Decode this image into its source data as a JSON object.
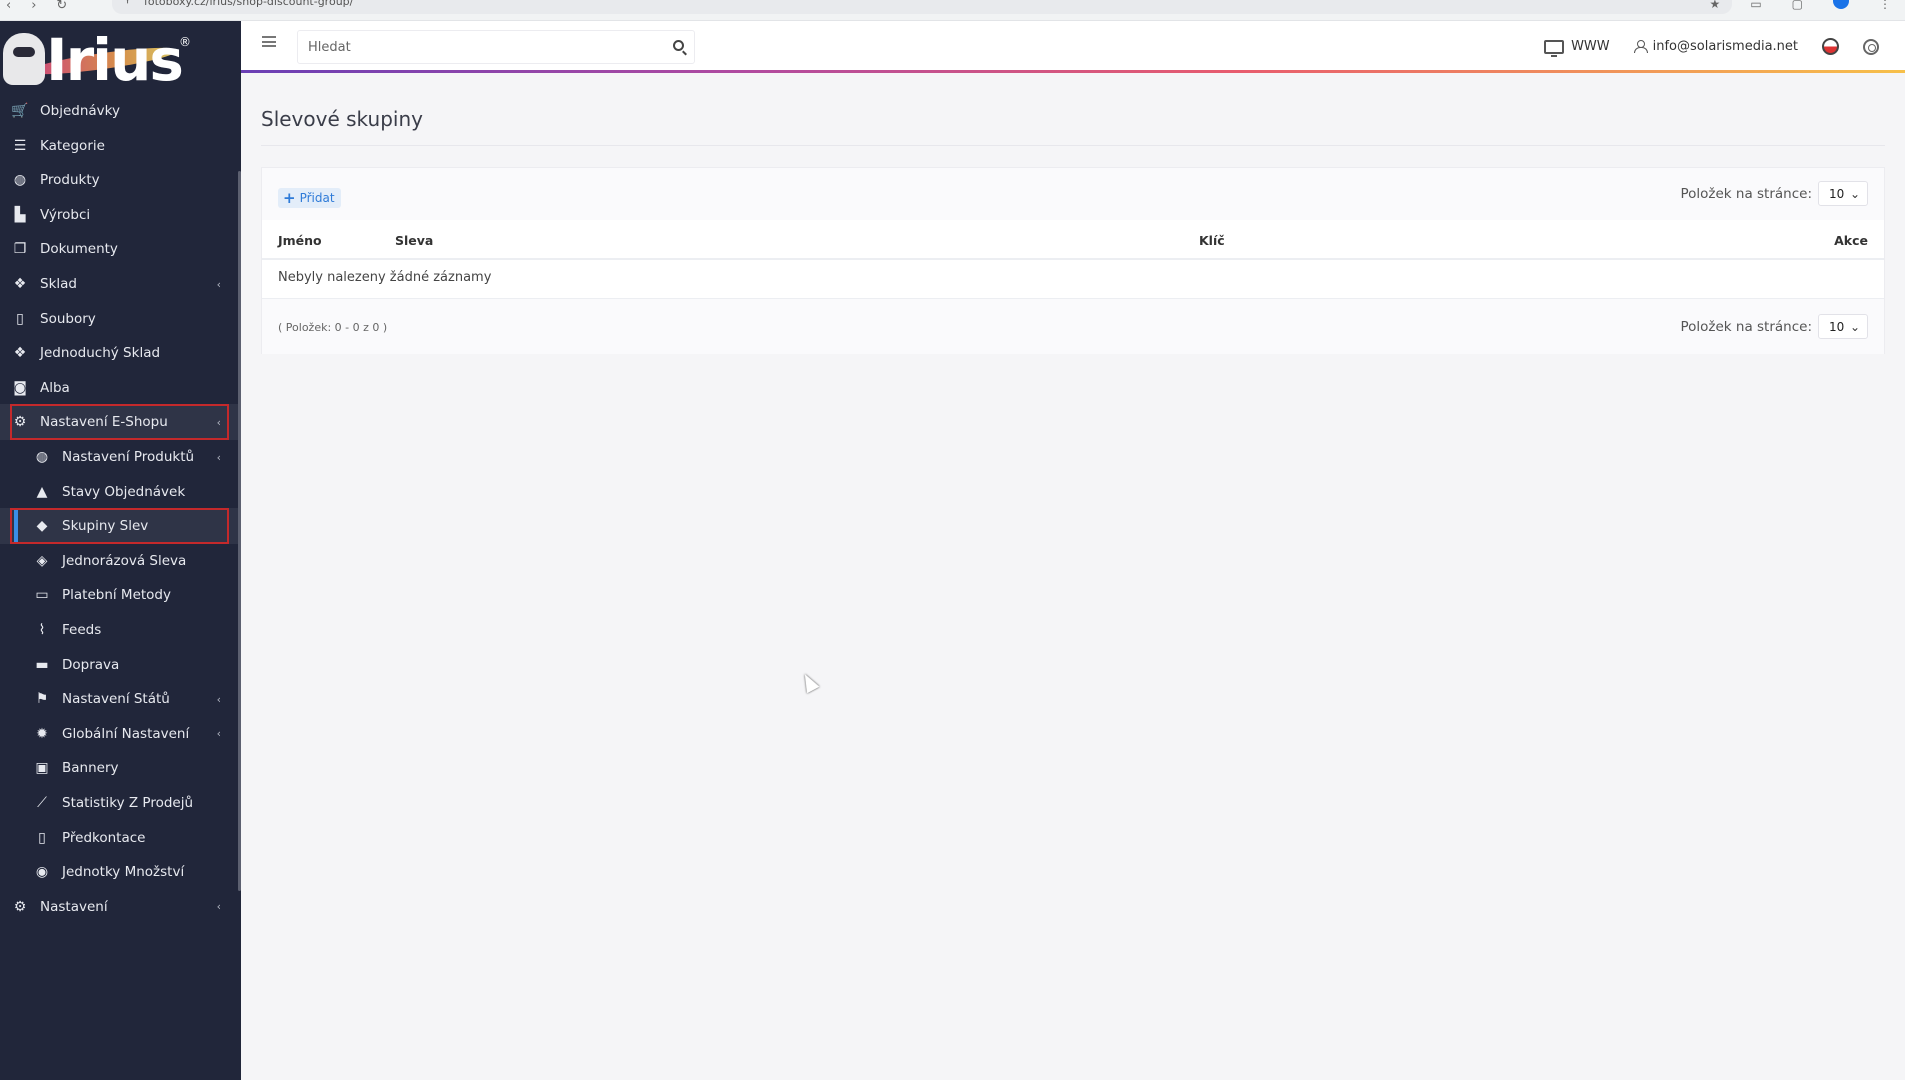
{
  "browser": {
    "url": "fotoboxy.cz/irius/shop-discount-group/",
    "nav_icons": [
      "back-icon",
      "forward-icon",
      "reload-icon"
    ]
  },
  "brand": {
    "logo_text": "Irius",
    "registered": "®"
  },
  "sidebar": {
    "items": [
      {
        "label": "Objednávky",
        "icon": "cart-icon",
        "sub": false
      },
      {
        "label": "Kategorie",
        "icon": "list-icon",
        "sub": false
      },
      {
        "label": "Produkty",
        "icon": "ball-icon",
        "sub": false
      },
      {
        "label": "Výrobci",
        "icon": "factory-icon",
        "sub": false
      },
      {
        "label": "Dokumenty",
        "icon": "documents-icon",
        "sub": false
      },
      {
        "label": "Sklad",
        "icon": "dropbox-icon",
        "sub": false,
        "chevron": "‹"
      },
      {
        "label": "Soubory",
        "icon": "file-icon",
        "sub": false
      },
      {
        "label": "Jednoduchý Sklad",
        "icon": "dropbox-icon",
        "sub": false
      },
      {
        "label": "Alba",
        "icon": "camera-icon",
        "sub": false
      },
      {
        "label": "Nastavení E-Shopu",
        "icon": "settings-icon",
        "sub": false,
        "chevron": "‹",
        "active": true
      },
      {
        "label": "Nastavení Produktů",
        "icon": "ball-icon",
        "sub": true,
        "chevron": "‹"
      },
      {
        "label": "Stavy Objednávek",
        "icon": "bell-icon",
        "sub": true
      },
      {
        "label": "Skupiny Slev",
        "icon": "tag-icon",
        "sub": true,
        "active": true
      },
      {
        "label": "Jednorázová Sleva",
        "icon": "tags-icon",
        "sub": true
      },
      {
        "label": "Platební Metody",
        "icon": "credit-card-icon",
        "sub": true
      },
      {
        "label": "Feeds",
        "icon": "feed-icon",
        "sub": true
      },
      {
        "label": "Doprava",
        "icon": "truck-icon",
        "sub": true
      },
      {
        "label": "Nastavení Států",
        "icon": "flag-icon",
        "sub": true,
        "chevron": "‹"
      },
      {
        "label": "Globální Nastavení",
        "icon": "gear-icon",
        "sub": true,
        "chevron": "‹"
      },
      {
        "label": "Bannery",
        "icon": "image-icon",
        "sub": true
      },
      {
        "label": "Statistiky Z Prodejů",
        "icon": "chart-icon",
        "sub": true
      },
      {
        "label": "Předkontace",
        "icon": "file-icon",
        "sub": true
      },
      {
        "label": "Jednotky Množství",
        "icon": "unit-icon",
        "sub": true
      },
      {
        "label": "Nastavení",
        "icon": "settings-icon",
        "sub": false,
        "chevron": "‹"
      }
    ]
  },
  "topbar": {
    "search_placeholder": "Hledat",
    "www_label": "WWW",
    "user_email": "info@solarismedia.net"
  },
  "page": {
    "title": "Slevové skupiny",
    "add_label": "Přidat",
    "per_page_label": "Položek na stránce:",
    "per_page_value": "10",
    "columns": {
      "name": "Jméno",
      "discount": "Sleva",
      "key": "Klíč",
      "actions": "Akce"
    },
    "empty_message": "Nebyly nalezeny žádné záznamy",
    "count_info": "( Položek: 0 - 0 z 0 )"
  }
}
